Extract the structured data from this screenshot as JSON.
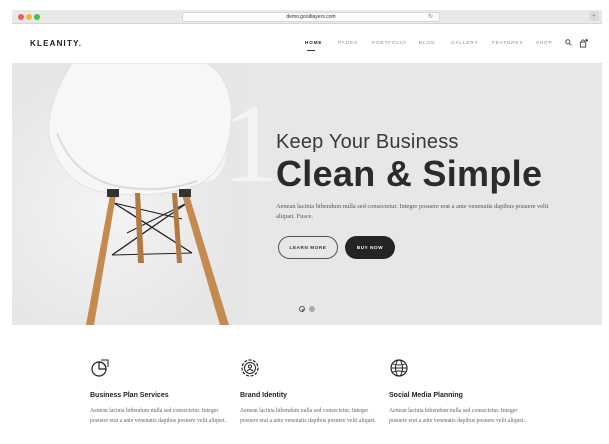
{
  "browser": {
    "url": "demo.goodlayers.com"
  },
  "header": {
    "logo": "KLEANITY.",
    "nav": [
      {
        "label": "HOME",
        "active": true
      },
      {
        "label": "PAGES"
      },
      {
        "label": "PORTFOLIO"
      },
      {
        "label": "BLOG"
      },
      {
        "label": "GALLERY"
      },
      {
        "label": "FEATURES"
      },
      {
        "label": "SHOP"
      }
    ],
    "icons": [
      "search-icon",
      "cart-icon"
    ]
  },
  "hero": {
    "slide_number": "01",
    "subheadline": "Keep Your Business",
    "headline": "Clean & Simple",
    "paragraph": "Aenean lacinia bibendum nulla sed consectetur. Integer posuere erat a ante venenatis dapibus posuere velit aliquet. Fusce.",
    "learn_more": "LEARN MORE",
    "buy_now": "BUY NOW",
    "slides": 2,
    "active_slide": 1
  },
  "services": [
    {
      "icon": "pie-chart-icon",
      "title": "Business Plan Services",
      "text": "Aenean lacinia bibendum nulla sed consectetur. Integer posuere erat a ante venenatis dapibus posuere velit aliquet."
    },
    {
      "icon": "gear-person-icon",
      "title": "Brand Identity",
      "text": "Aenean lacinia bibendum nulla sed consectetur. Integer posuere erat a ante venenatis dapibus posuere velit aliquet."
    },
    {
      "icon": "globe-icon",
      "title": "Social Media Planning",
      "text": "Aenean lacinia bibendum nulla sed consectetur. Integer posuere erat a ante venenatis dapibus posuere velit aliquet."
    }
  ],
  "colors": {
    "hero_bg": "#e7e7e7",
    "dark_button": "#242424",
    "chair_leg": "#c58a4f"
  }
}
